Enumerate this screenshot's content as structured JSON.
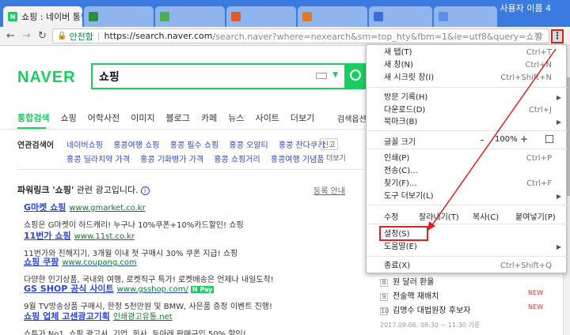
{
  "browser": {
    "tabs": [
      {
        "label": "쇼핑 : 네이버 통합검색",
        "active": true
      },
      {
        "label": "",
        "active": false
      },
      {
        "label": "",
        "active": false
      },
      {
        "label": "",
        "active": false
      },
      {
        "label": "",
        "active": false
      },
      {
        "label": "",
        "active": false
      },
      {
        "label": "",
        "active": false
      }
    ],
    "user": "사용자 이름 4",
    "secure_label": "안전함",
    "url_host": "https://search.naver.com",
    "url_path": "/search.naver?where=nexearch&sm=top_hty&fbm=1&ie=utf8&query=쇼핑",
    "menu_icon": "⋮"
  },
  "naver": {
    "logo": "NAVER",
    "query": "쇼핑",
    "tabs": [
      "통합검색",
      "쇼핑",
      "어학사전",
      "이미지",
      "블로그",
      "카페",
      "뉴스",
      "사이트",
      "더보기"
    ],
    "search_options": "검색옵션"
  },
  "related": {
    "title": "연관검색어",
    "row1": [
      "네이버쇼핑",
      "홍콩여행 쇼핑",
      "홍콩 필수 쇼핑",
      "홍콩 오알티",
      "홍콩 잔다쿠키"
    ],
    "row2": [
      "홍콩 딜라치약 가격",
      "홍콩 기화병가 가격",
      "홍콩 쇼핑거리",
      "홍콩여행 기념품"
    ],
    "report": "신고",
    "more": "더보기"
  },
  "powerlink": {
    "title_prefix": "파워링크 '쇼핑'",
    "title_suffix": " 관련 광고입니다.",
    "register": "등록 안내",
    "ads": [
      {
        "title": "G마켓 쇼핑",
        "url": "www.gmarket.co.kr",
        "desc": "쇼핑은 G마켓이 하드캐리! 누구나 10%쿠폰+10%카드할인! 쇼핑",
        "pay": ""
      },
      {
        "title": "11번가 쇼핑",
        "url": "www.11st.co.kr",
        "desc": "11번가와 친해지기, 3개월 이내 첫 구매시 30% 쿠폰 지급! 쇼핑",
        "pay": ""
      },
      {
        "title": "쇼핑 쿠팡",
        "url": "www.coupang.com",
        "desc": "다양한 인기상품, 국내외 여행, 로켓직구 특가! 로켓배송은 언제나 내일도착!",
        "pay": ""
      },
      {
        "title": "GS SHOP 공식 사이트",
        "url": "www.gsshop.com/",
        "desc": "9월 TV방송상품 구매시, 한정 5천만원 및 BMW, 사은품 증정 이벤트 진행!",
        "pay": "N Pay"
      },
      {
        "title": "쇼핑 업체 고센광고기획",
        "url": "인쇄광고유통.net",
        "desc": "쇼투가 No1, 쇼핑 광고서, 기업, 회사, 등아래 판매구입 50% 할인!",
        "pay": ""
      }
    ]
  },
  "ranking": {
    "items": [
      {
        "num": "8",
        "text": "원 달러 환율",
        "badge": ""
      },
      {
        "num": "9",
        "text": "전술핵 재배치",
        "badge": "NEW"
      },
      {
        "num": "10",
        "text": "김명수 대법원장 후보자",
        "badge": "NEW"
      }
    ],
    "time": "2017.09.06. 08:30 ~ 11:30 기준"
  },
  "chrome_menu": {
    "new_tab": "새 탭(T)",
    "new_tab_sc": "Ctrl+T",
    "new_window": "새 창(N)",
    "new_window_sc": "Ctrl+N",
    "incognito": "새 시크릿 창(I)",
    "incognito_sc": "Ctrl+Shift+N",
    "history": "방문 기록(H)",
    "downloads": "다운로드(D)",
    "downloads_sc": "Ctrl+J",
    "bookmarks": "북마크(B)",
    "zoom_label": "글꼴 크기",
    "zoom_minus": "-",
    "zoom_value": "100%",
    "zoom_plus": "+",
    "print": "인쇄(P)",
    "print_sc": "Ctrl+P",
    "cast": "전송(C)...",
    "find": "찾기(F)...",
    "find_sc": "Ctrl+F",
    "more_tools": "도구 더보기(L)",
    "edit_label": "수정",
    "cut": "잘라내기(T)",
    "copy": "복사(C)",
    "paste": "붙여넣기(P)",
    "settings": "설정(S)",
    "help": "도움말(E)",
    "exit": "종료(X)",
    "exit_sc": "Ctrl+Shift+Q"
  },
  "colors": {
    "naver_green": "#19ce60",
    "chrome_blue": "#3b7be0",
    "highlight_red": "#e02020",
    "link_blue": "#2b44d9"
  }
}
